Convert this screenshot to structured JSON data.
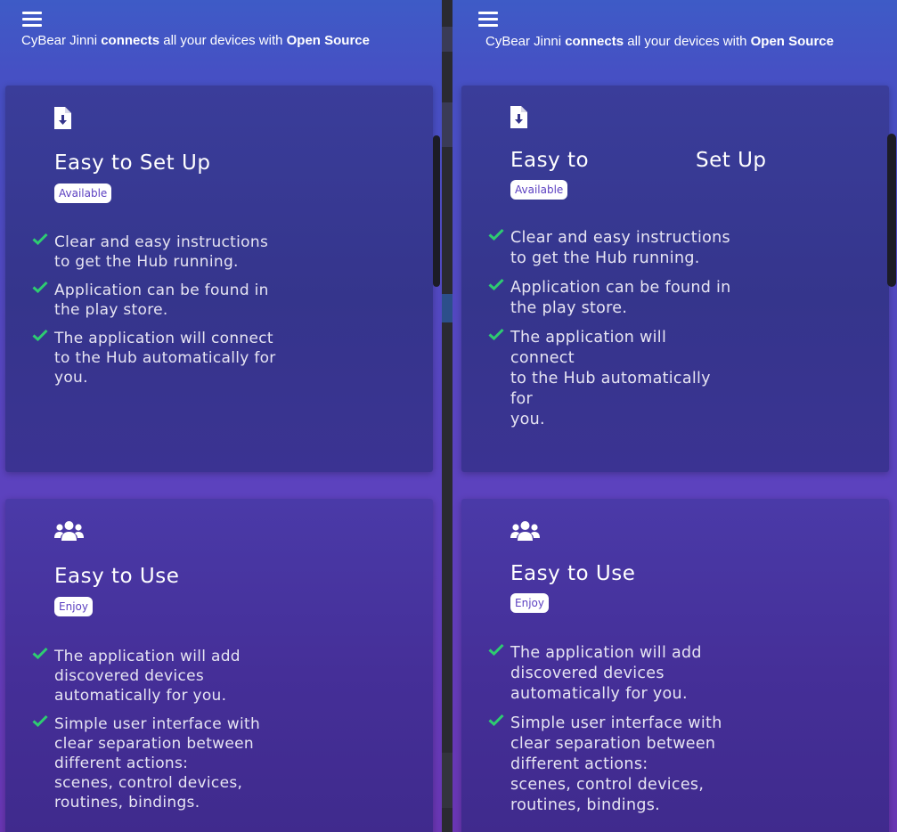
{
  "header": {
    "tagline_pre": "CyBear Jinni ",
    "tagline_b1": "connects",
    "tagline_mid": " all your devices with ",
    "tagline_b2": "Open Source"
  },
  "cards": [
    {
      "icon": "file-download-icon",
      "title": "Easy to Set Up",
      "title_left": "Easy to",
      "title_right": "Set Up",
      "badge": "Available",
      "features": [
        "Clear and easy instructions\nto get the Hub running.",
        "Application can be found in\nthe play store.",
        "The application will connect\nto the Hub automatically for\nyou."
      ]
    },
    {
      "icon": "users-icon",
      "title": "Easy to Use",
      "badge": "Enjoy",
      "features": [
        "The application will add\ndiscovered devices\nautomatically for you.",
        "Simple user interface with\nclear separation between\ndifferent actions:\nscenes, control devices,\nroutines, bindings."
      ]
    }
  ],
  "colors": {
    "check": "#2ecc71",
    "badge_text": "#5b3fc1",
    "panel_top": "#3e5bc6",
    "panel_bottom": "#6a36b4"
  }
}
